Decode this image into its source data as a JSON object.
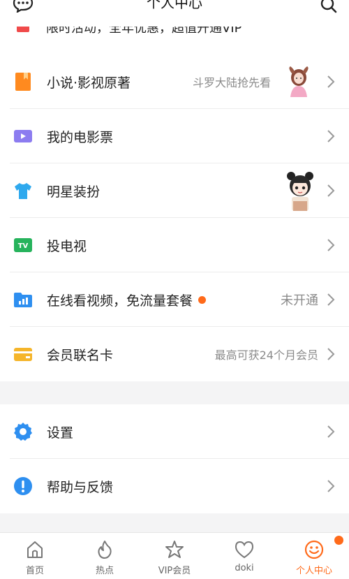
{
  "header": {
    "title": "个人中心"
  },
  "peek": {
    "text": "限时活动，全年优惠，超值开通VIP",
    "sub": ""
  },
  "menu_group1": [
    {
      "key": "novel",
      "label": "小说·影视原著",
      "sub": "斗罗大陆抢先看"
    },
    {
      "key": "ticket",
      "label": "我的电影票",
      "sub": ""
    },
    {
      "key": "dress",
      "label": "明星装扮",
      "sub": ""
    },
    {
      "key": "tv",
      "label": "投电视",
      "sub": ""
    },
    {
      "key": "flow",
      "label": "在线看视频，免流量套餐",
      "sub": "未开通"
    },
    {
      "key": "card",
      "label": "会员联名卡",
      "sub": "最高可获24个月会员"
    }
  ],
  "menu_group2": [
    {
      "key": "settings",
      "label": "设置",
      "sub": ""
    },
    {
      "key": "help",
      "label": "帮助与反馈",
      "sub": ""
    }
  ],
  "tabs": [
    {
      "label": "首页",
      "icon": "home-icon"
    },
    {
      "label": "热点",
      "icon": "flame-icon"
    },
    {
      "label": "VIP会员",
      "icon": "vip-star-icon"
    },
    {
      "label": "doki",
      "icon": "doki-heart-icon"
    },
    {
      "label": "个人中心",
      "icon": "smiley-icon"
    }
  ],
  "colors": {
    "accent": "#ff6a1a",
    "background": "#f4f4f5",
    "divider": "#ececec"
  }
}
